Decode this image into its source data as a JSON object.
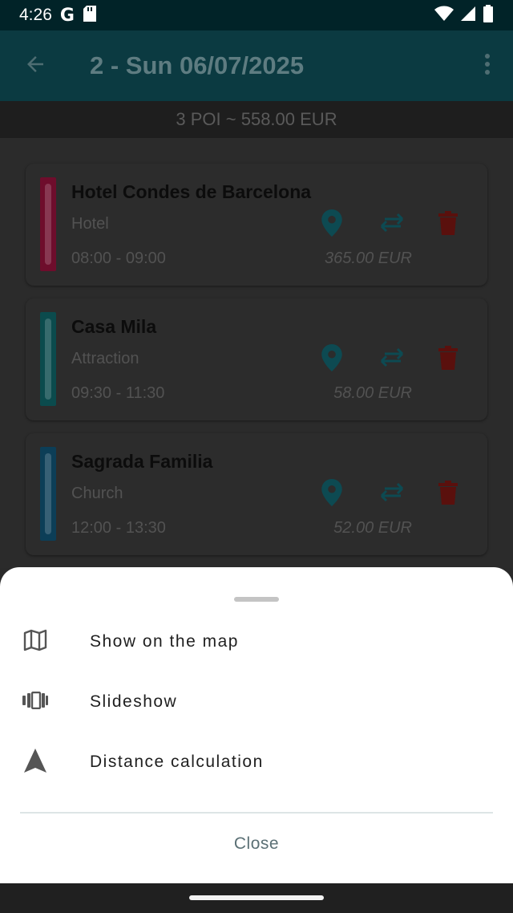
{
  "status_bar": {
    "time": "4:26",
    "google_glyph": "G"
  },
  "app_bar": {
    "title": "2 - Sun 06/07/2025"
  },
  "summary": {
    "text": "3 POI ~ 558.00 EUR"
  },
  "pois": [
    {
      "name": "Hotel Condes de Barcelona",
      "type": "Hotel",
      "time": "08:00 - 09:00",
      "price": "365.00 EUR",
      "color": "#6e0d2c"
    },
    {
      "name": "Casa Mila",
      "type": "Attraction",
      "time": "09:30 - 11:30",
      "price": "58.00 EUR",
      "color": "#0b4b4d"
    },
    {
      "name": "Sagrada Familia",
      "type": "Church",
      "time": "12:00 - 13:30",
      "price": "52.00 EUR",
      "color": "#0c3e57"
    }
  ],
  "colors": {
    "accent_teal": "#0d4a52",
    "delete_red": "#5a100d",
    "appbar": "#0b3a41"
  },
  "bottom_sheet": {
    "items": [
      {
        "label": "Show on the map",
        "icon": "map-icon"
      },
      {
        "label": "Slideshow",
        "icon": "slideshow-icon"
      },
      {
        "label": "Distance calculation",
        "icon": "navigation-arrow-icon"
      }
    ],
    "close_label": "Close"
  }
}
